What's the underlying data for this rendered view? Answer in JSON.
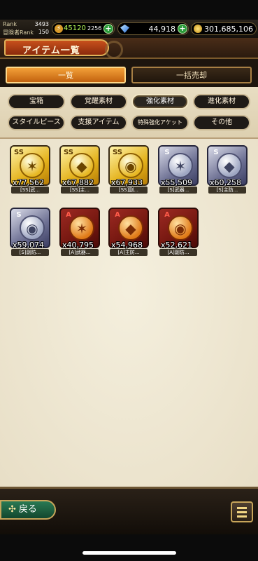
{
  "status": {
    "rank_label": "Rank",
    "rank_value": "3493",
    "sub_rank_label": "冒険者Rank",
    "sub_rank_value": "150",
    "stamina_current": "45120",
    "stamina_max": "2256",
    "gems": "44,918",
    "gold": "301,685,106"
  },
  "title": "アイテム一覧",
  "tabs": [
    {
      "label": "一覧",
      "active": true
    },
    {
      "label": "一括売却",
      "active": false
    }
  ],
  "filters": [
    {
      "label": "宝箱",
      "active": false
    },
    {
      "label": "覚醒素材",
      "active": false
    },
    {
      "label": "強化素材",
      "active": true
    },
    {
      "label": "進化素材",
      "active": false
    },
    {
      "label": "スタイルピース",
      "active": false
    },
    {
      "label": "支援アイテム",
      "active": false
    },
    {
      "label": "特殊強化アケット",
      "active": false
    },
    {
      "label": "その他",
      "active": false
    }
  ],
  "items": [
    {
      "rank": "SS",
      "qty": "x77,562",
      "name": "[SS]武..."
    },
    {
      "rank": "SS",
      "qty": "x67,882",
      "name": "[SS]主..."
    },
    {
      "rank": "SS",
      "qty": "x67,933",
      "name": "[SS]副..."
    },
    {
      "rank": "S",
      "qty": "x55,509",
      "name": "[S]武器..."
    },
    {
      "rank": "S",
      "qty": "x60,258",
      "name": "[S]主防..."
    },
    {
      "rank": "S",
      "qty": "x59,074",
      "name": "[S]副防..."
    },
    {
      "rank": "A",
      "qty": "x40,795",
      "name": "[A]武器..."
    },
    {
      "rank": "A",
      "qty": "x54,968",
      "name": "[A]主防..."
    },
    {
      "rank": "A",
      "qty": "x52,621",
      "name": "[A]副防..."
    }
  ],
  "bottom": {
    "back_label": "戻る"
  }
}
